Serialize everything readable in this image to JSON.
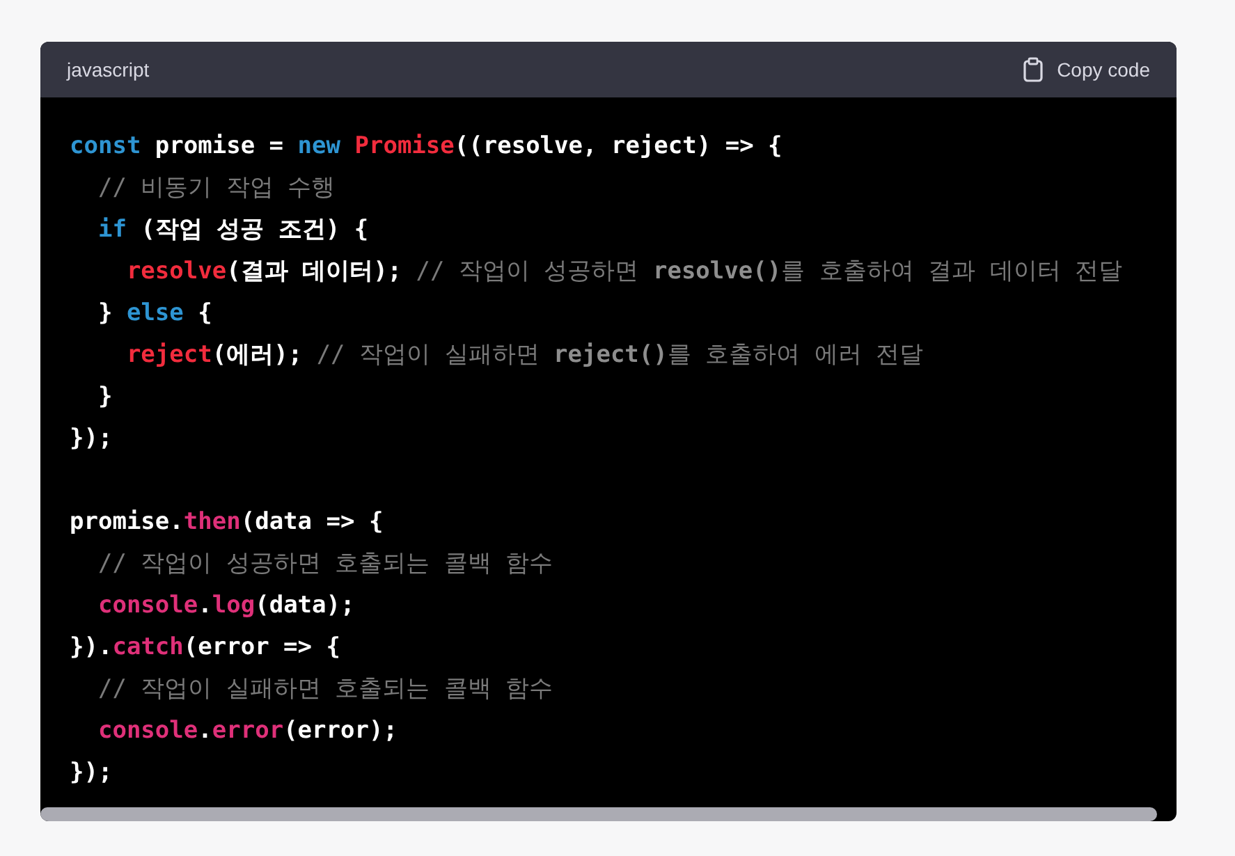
{
  "code_block": {
    "language": "javascript",
    "copy_button": {
      "label": "Copy code"
    },
    "lines": [
      {
        "kind": "code",
        "tokens": [
          {
            "kind": "keyword",
            "text": "const"
          },
          {
            "kind": "plain",
            "text": " promise = "
          },
          {
            "kind": "keyword",
            "text": "new "
          },
          {
            "kind": "class",
            "text": "Promise"
          },
          {
            "kind": "plain",
            "text": "((resolve, reject) => {"
          }
        ]
      },
      {
        "kind": "code",
        "tokens": [
          {
            "kind": "comment",
            "text": "  // 비동기 작업 수행"
          }
        ]
      },
      {
        "kind": "code",
        "tokens": [
          {
            "kind": "keyword",
            "text": "  if"
          },
          {
            "kind": "plain",
            "text": " (작업 성공 조건) {"
          }
        ]
      },
      {
        "kind": "code",
        "tokens": [
          {
            "kind": "call",
            "text": "    resolve"
          },
          {
            "kind": "plain",
            "text": "(결과 데이터); "
          },
          {
            "kind": "comment",
            "text": "// 작업이 성공하면 **resolve()**를 호출하여 결과 데이터 전달"
          }
        ]
      },
      {
        "kind": "code",
        "tokens": [
          {
            "kind": "plain",
            "text": "  } "
          },
          {
            "kind": "keyword",
            "text": "else"
          },
          {
            "kind": "plain",
            "text": " {"
          }
        ]
      },
      {
        "kind": "code",
        "tokens": [
          {
            "kind": "call",
            "text": "    reject"
          },
          {
            "kind": "plain",
            "text": "(에러); "
          },
          {
            "kind": "comment",
            "text": "// 작업이 실패하면 **reject()**를 호출하여 에러 전달"
          }
        ]
      },
      {
        "kind": "code",
        "tokens": [
          {
            "kind": "plain",
            "text": "  }"
          }
        ]
      },
      {
        "kind": "code",
        "tokens": [
          {
            "kind": "plain",
            "text": "});"
          }
        ]
      },
      {
        "kind": "blank"
      },
      {
        "kind": "code",
        "tokens": [
          {
            "kind": "plain",
            "text": "promise."
          },
          {
            "kind": "method",
            "text": "then"
          },
          {
            "kind": "plain",
            "text": "(data => {"
          }
        ]
      },
      {
        "kind": "code",
        "tokens": [
          {
            "kind": "comment",
            "text": "  // 작업이 성공하면 호출되는 콜백 함수"
          }
        ]
      },
      {
        "kind": "code",
        "tokens": [
          {
            "kind": "method",
            "text": "  console"
          },
          {
            "kind": "plain",
            "text": "."
          },
          {
            "kind": "method",
            "text": "log"
          },
          {
            "kind": "plain",
            "text": "(data);"
          }
        ]
      },
      {
        "kind": "code",
        "tokens": [
          {
            "kind": "plain",
            "text": "})."
          },
          {
            "kind": "method",
            "text": "catch"
          },
          {
            "kind": "plain",
            "text": "(error => {"
          }
        ]
      },
      {
        "kind": "code",
        "tokens": [
          {
            "kind": "comment",
            "text": "  // 작업이 실패하면 호출되는 콜백 함수"
          }
        ]
      },
      {
        "kind": "code",
        "tokens": [
          {
            "kind": "method",
            "text": "  console"
          },
          {
            "kind": "plain",
            "text": "."
          },
          {
            "kind": "method",
            "text": "error"
          },
          {
            "kind": "plain",
            "text": "(error);"
          }
        ]
      },
      {
        "kind": "code",
        "tokens": [
          {
            "kind": "plain",
            "text": "});"
          }
        ]
      }
    ]
  }
}
